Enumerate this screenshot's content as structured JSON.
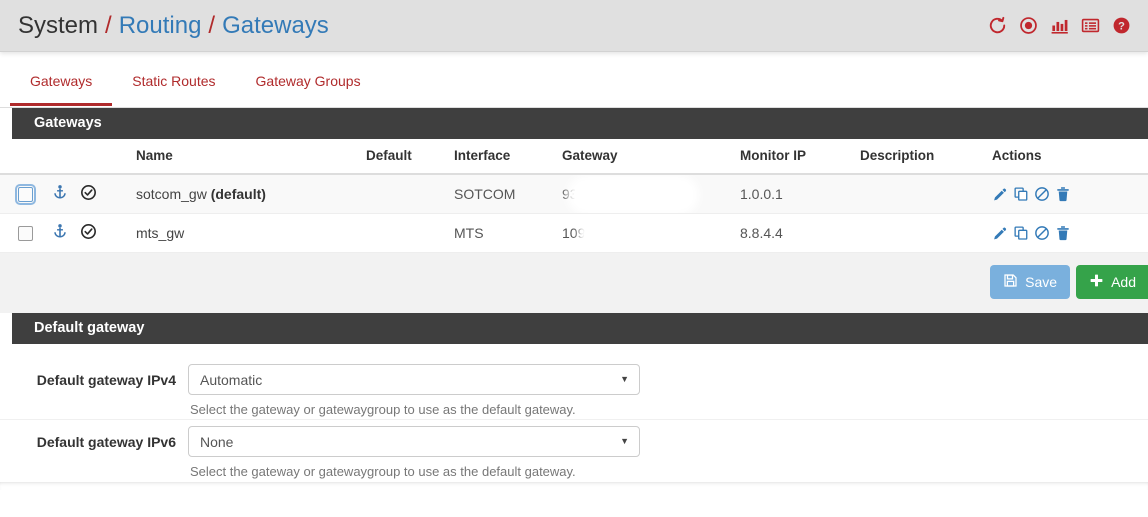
{
  "header": {
    "breadcrumb": {
      "root": "System",
      "sep": "/",
      "link1": "Routing",
      "link2": "Gateways"
    },
    "icons": [
      {
        "name": "refresh-icon",
        "title": "Refresh"
      },
      {
        "name": "stop-icon",
        "title": "Stop"
      },
      {
        "name": "chart-icon",
        "title": "Monitoring"
      },
      {
        "name": "log-icon",
        "title": "Logs"
      },
      {
        "name": "help-icon",
        "title": "Help"
      }
    ]
  },
  "tabs": [
    {
      "label": "Gateways",
      "active": true
    },
    {
      "label": "Static Routes",
      "active": false
    },
    {
      "label": "Gateway Groups",
      "active": false
    }
  ],
  "gateways_panel": {
    "title": "Gateways",
    "columns": [
      "Name",
      "Default",
      "Interface",
      "Gateway",
      "Monitor IP",
      "Description",
      "Actions"
    ],
    "rows": [
      {
        "selected": false,
        "focused": true,
        "status": "online",
        "name": "sotcom_gw",
        "name_suffix": "(default)",
        "default": "",
        "interface": "SOTCOM",
        "gateway": "93.",
        "gateway_redacted": true,
        "monitor_ip": "1.0.0.1",
        "description": "",
        "actions": [
          "edit-icon",
          "copy-icon",
          "disable-icon",
          "delete-icon"
        ]
      },
      {
        "selected": false,
        "focused": false,
        "status": "online",
        "name": "mts_gw",
        "name_suffix": "",
        "default": "",
        "interface": "MTS",
        "gateway": "109",
        "gateway_redacted": true,
        "monitor_ip": "8.8.4.4",
        "description": "",
        "actions": [
          "edit-icon",
          "copy-icon",
          "disable-icon",
          "delete-icon"
        ]
      }
    ],
    "buttons": {
      "save": "Save",
      "add": "Add"
    }
  },
  "default_gateway_panel": {
    "title": "Default gateway",
    "rows": [
      {
        "label": "Default gateway IPv4",
        "value": "Automatic",
        "help": "Select the gateway or gatewaygroup to use as the default gateway."
      },
      {
        "label": "Default gateway IPv6",
        "value": "None",
        "help": "Select the gateway or gatewaygroup to use as the default gateway."
      }
    ]
  },
  "colors": {
    "brand_red": "#b02b2c",
    "link_blue": "#337ab7",
    "panel_dark": "#3f3f3f",
    "save_blue": "#7ab0dd",
    "add_green": "#35a34a"
  }
}
